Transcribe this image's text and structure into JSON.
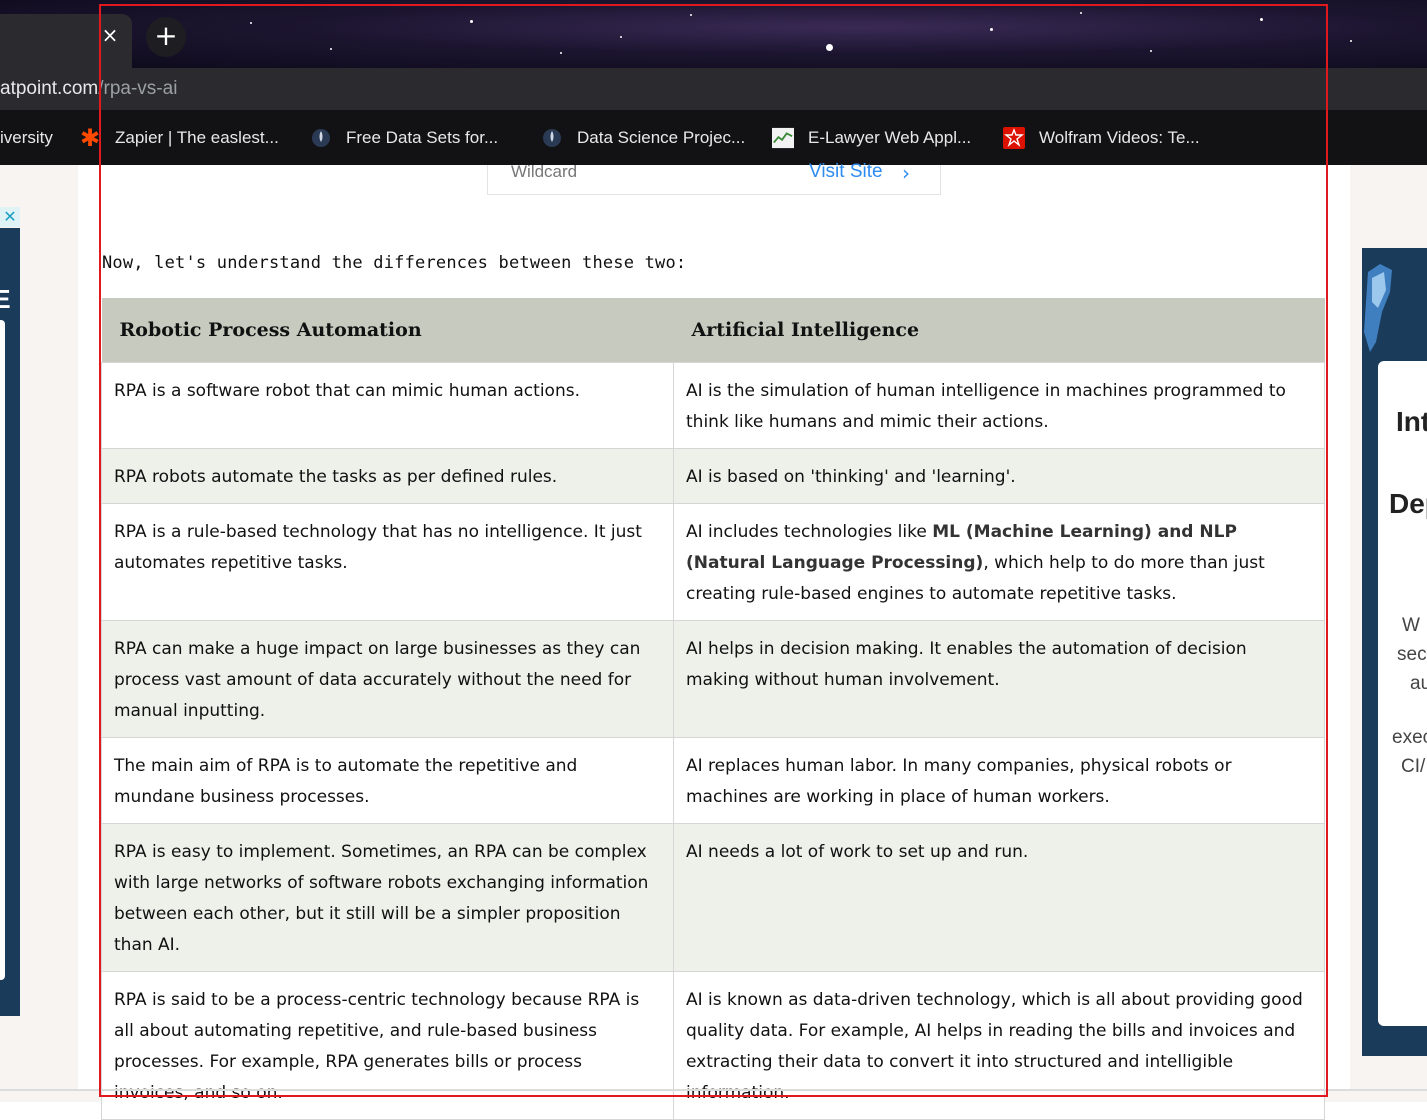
{
  "browser": {
    "tab_close_glyph": "×",
    "new_tab_glyph": "+",
    "url_host": "atpoint.com",
    "url_path": "/rpa-vs-ai",
    "bookmarks": [
      {
        "label": "iversity",
        "icon": "none"
      },
      {
        "label": "Zapier | The easlest...",
        "icon": "zapier-icon",
        "color": "#ff4a00"
      },
      {
        "label": "Free Data Sets for...",
        "icon": "rocket-icon"
      },
      {
        "label": "Data Science Projec...",
        "icon": "rocket-icon"
      },
      {
        "label": "E-Lawyer Web Appl...",
        "icon": "chart-thumbnail-icon"
      },
      {
        "label": "Wolfram Videos: Te...",
        "icon": "wolfram-icon",
        "color": "#dd1100"
      }
    ]
  },
  "sponsor": {
    "label": "Wildcard",
    "link": "Visit Site"
  },
  "ads": {
    "left_close": "✕",
    "left_text": "IE",
    "right_lines": [
      "Int",
      "Dep",
      "W",
      "sec",
      "au",
      "exec",
      "CI/"
    ]
  },
  "article": {
    "intro": "Now, let's understand the differences between these two:",
    "table": {
      "headers": [
        "Robotic Process Automation",
        "Artificial Intelligence"
      ],
      "rows": [
        {
          "rpa": "RPA is a software robot that can mimic human actions.",
          "ai": "AI is the simulation of human intelligence in machines programmed to think like humans and mimic their actions."
        },
        {
          "rpa": "RPA robots automate the tasks as per defined rules.",
          "ai": "AI is based on 'thinking' and 'learning'."
        },
        {
          "rpa": "RPA is a rule-based technology that has no intelligence. It just automates repetitive tasks.",
          "ai_pre": "AI includes technologies like ",
          "ai_bold": "ML (Machine Learning) and NLP (Natural Language Processing)",
          "ai_post": ", which help to do more than just creating rule-based engines to automate repetitive tasks."
        },
        {
          "rpa": "RPA can make a huge impact on large businesses as they can process vast amount of data accurately without the need for manual inputting.",
          "ai": "AI helps in decision making. It enables the automation of decision making without human involvement."
        },
        {
          "rpa": "The main aim of RPA is to automate the repetitive and mundane business processes.",
          "ai": "AI replaces human labor. In many companies, physical robots or machines are working in place of human workers."
        },
        {
          "rpa": "RPA is easy to implement. Sometimes, an RPA can be complex with large networks of software robots exchanging information between each other, but it still will be a simpler proposition than AI.",
          "ai": "AI needs a lot of work to set up and run."
        },
        {
          "rpa": "RPA is said to be a process-centric technology because RPA is all about automating repetitive, and rule-based business processes. For example, RPA generates bills or process invoices, and so on.",
          "ai": "AI is known as data-driven technology, which is all about providing good quality data. For example, AI helps in reading the bills and invoices and extracting their data to convert it into structured and intelligible information."
        }
      ]
    }
  }
}
